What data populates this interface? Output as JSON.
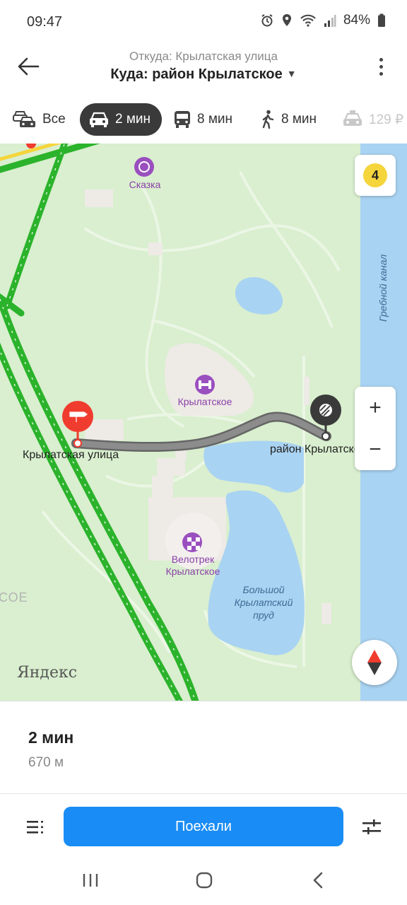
{
  "status_bar": {
    "time": "09:47",
    "battery": "84%",
    "icons": [
      "alarm-icon",
      "location-icon",
      "wifi-icon",
      "signal-icon",
      "battery-icon"
    ]
  },
  "header": {
    "from": "Откуда: Крылатская улица",
    "to": "Куда: район Крылатское",
    "back_icon": "arrow-left-icon",
    "menu_icon": "more-vertical-icon"
  },
  "modes": [
    {
      "icon": "car-multi-icon",
      "label": "Все",
      "active": false
    },
    {
      "icon": "car-icon",
      "label": "2 мин",
      "active": true
    },
    {
      "icon": "bus-icon",
      "label": "8 мин",
      "active": false
    },
    {
      "icon": "walk-icon",
      "label": "8 мин",
      "active": false
    },
    {
      "icon": "taxi-icon",
      "label": "129 ₽",
      "active": false
    }
  ],
  "map": {
    "traffic_level": "4",
    "labels": {
      "start": "Крылатская улица",
      "end": "район Крылатское",
      "skazka": "Сказка",
      "krylatskoe": "Крылатское",
      "velotrek_line1": "Велотрек",
      "velotrek_line2": "Крылатское",
      "pond_line1": "Большой",
      "pond_line2": "Крылатский",
      "pond_line3": "пруд",
      "canal": "Гребной канал",
      "edge": "СОЕ",
      "watermark": "Яндекс"
    },
    "zoom_in": "+",
    "zoom_out": "−",
    "colors": {
      "park": "#d9efcf",
      "water": "#a9d3f2",
      "route": "#7a7a7a",
      "traffic": "#2bb32b",
      "start_pin": "#f03c2e",
      "end_pin": "#3a3a3a"
    }
  },
  "route": {
    "time": "2 мин",
    "distance": "670 м"
  },
  "actions": {
    "go": "Поехали",
    "go_color": "#1a8cf5"
  }
}
